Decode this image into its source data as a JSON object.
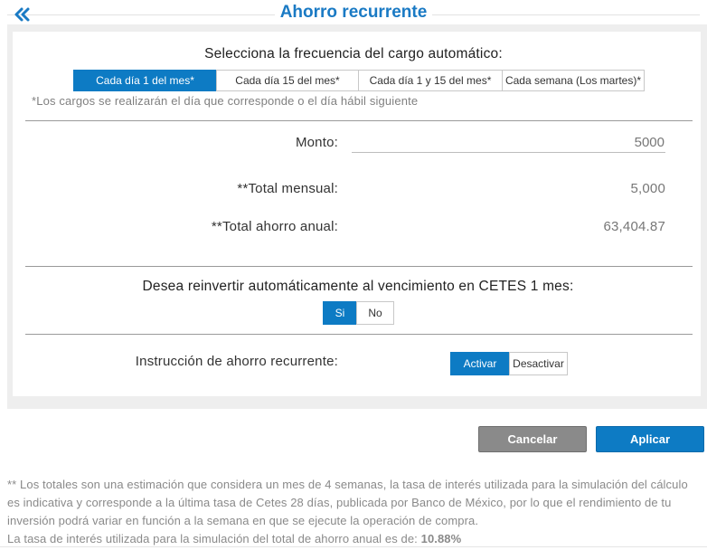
{
  "header": {
    "title": "Ahorro recurrente",
    "back_icon": "double-chevron-left-icon"
  },
  "frequency": {
    "heading": "Selecciona la frecuencia del cargo automático:",
    "options": [
      "Cada día 1 del mes*",
      "Cada día 15 del mes*",
      "Cada día 1 y 15 del mes*",
      "Cada semana (Los martes)*"
    ],
    "selected": "Cada día 1 del mes*",
    "note": "*Los cargos se realizarán el día que corresponde o el día hábil siguiente"
  },
  "amounts": {
    "monto_label": "Monto:",
    "monto_value": "5000",
    "total_mensual_label": "**Total mensual:",
    "total_mensual_value": "5,000",
    "total_anual_label": "**Total ahorro anual:",
    "total_anual_value": "63,404.87"
  },
  "reinvest": {
    "heading": "Desea reinvertir automáticamente al vencimiento en CETES 1 mes:",
    "options": [
      "Si",
      "No"
    ],
    "selected": "Si"
  },
  "instruction": {
    "label": "Instrucción de ahorro recurrente:",
    "options": [
      "Activar",
      "Desactivar"
    ],
    "selected": "Activar"
  },
  "actions": {
    "cancel": "Cancelar",
    "apply": "Aplicar"
  },
  "footnote": {
    "text": "** Los totales son una estimación que considera un mes de 4 semanas, la tasa de interés utilizada para la simulación del cálculo es indicativa y corresponde a la última tasa de Cetes 28 días, publicada por Banco de México, por lo que el rendimiento de tu inversión podrá variar en función a la semana en que se ejecute la operación de compra.",
    "rate_text": "La tasa de interés utilizada para la simulación del total de ahorro anual es de:",
    "rate_value": "10.88%"
  },
  "colors": {
    "accent": "#0d7bc4",
    "title": "#1a7ac4",
    "cancel": "#8a8a8a"
  }
}
